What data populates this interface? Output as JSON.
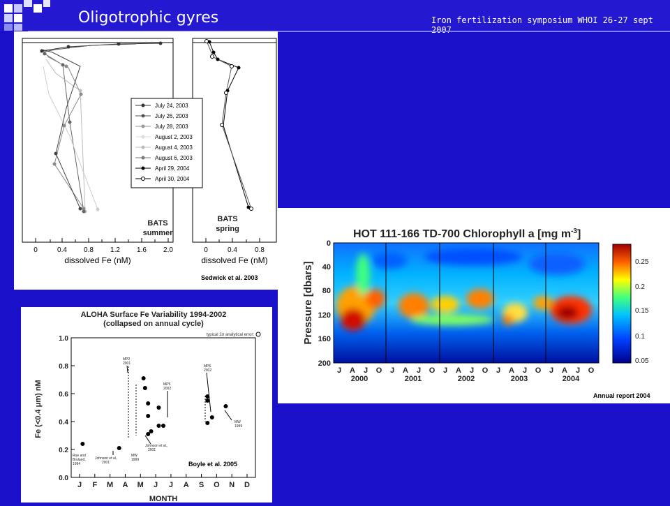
{
  "header": {
    "title": "Oligotrophic gyres",
    "subtitle": "Iron fertilization symposium  WHOI 26-27 sept 2007"
  },
  "panels": {
    "bats": {
      "citation": "Sedwick et al. 2003",
      "left_label": [
        "BATS",
        "summer"
      ],
      "right_label": [
        "BATS",
        "spring"
      ],
      "xlabel": "dissolved Fe (nM)",
      "left_ticks": [
        "0",
        "0.4",
        "0.8",
        "1.2",
        "1.6",
        "2.0"
      ],
      "right_ticks": [
        "0",
        "0.4",
        "0.8"
      ],
      "legend": [
        "July 24, 2003",
        "July 26, 2003",
        "July 28, 2003",
        "August 2, 2003",
        "August 4, 2003",
        "August 6, 2003",
        "April 29, 2004",
        "April 30, 2004"
      ]
    },
    "hot": {
      "title": "HOT 111-166 TD-700 Chlorophyll a [mg m",
      "title_sup": "-3",
      "title_end": "]",
      "ylabel": "Pressure [dbars]",
      "yticks": [
        "0",
        "40",
        "80",
        "120",
        "160",
        "200"
      ],
      "month_letters": [
        "J",
        "A",
        "J",
        "O",
        "J",
        "A",
        "J",
        "O",
        "J",
        "A",
        "J",
        "O",
        "J",
        "A",
        "J",
        "O",
        "J",
        "A",
        "J",
        "O"
      ],
      "years": [
        "2000",
        "2001",
        "2002",
        "2003",
        "2004"
      ],
      "colorbar_ticks": [
        "0.25",
        "0.2",
        "0.15",
        "0.1",
        "0.05"
      ],
      "citation": "Annual report 2004"
    },
    "aloha": {
      "title_line1": "ALOHA Surface Fe Variability 1994-2002",
      "title_line2": "(collapsed on annual cycle)",
      "error_note": "typical 2σ analytical error:",
      "ylabel": "Fe (<0.4 μm) nM",
      "xlabel": "MONTH",
      "yticks": [
        "0.0",
        "0.2",
        "0.4",
        "0.6",
        "0.8",
        "1.0"
      ],
      "months": [
        "J",
        "F",
        "M",
        "A",
        "M",
        "J",
        "J",
        "A",
        "S",
        "O",
        "N",
        "D"
      ],
      "citation": "Boyle et al. 2005",
      "annotations": [
        "MP2\n2001",
        "MP5\n2002",
        "MP6\n2002",
        "Johnson et al.,\n2001",
        "Johnson et al.,\n2001",
        "MW\n1999",
        "MW\n1999",
        "Rue and\nBruland,\n1994"
      ]
    }
  },
  "chart_data": [
    {
      "type": "scatter",
      "title": "ALOHA Surface Fe Variability 1994-2002 (collapsed on annual cycle)",
      "xlabel": "MONTH",
      "ylabel": "Fe (<0.4 μm) nM",
      "ylim": [
        0,
        1.0
      ],
      "x": [
        "J",
        "J",
        "M",
        "M",
        "M",
        "M",
        "M",
        "M",
        "M",
        "J",
        "J",
        "J",
        "O",
        "O",
        "O",
        "O",
        "O",
        "N"
      ],
      "points": [
        {
          "month": 1.2,
          "value": 0.24
        },
        {
          "month": 3.6,
          "value": 0.21
        },
        {
          "month": 5.2,
          "value": 0.71
        },
        {
          "month": 5.3,
          "value": 0.64
        },
        {
          "month": 5.5,
          "value": 0.53
        },
        {
          "month": 5.5,
          "value": 0.44
        },
        {
          "month": 5.7,
          "value": 0.33
        },
        {
          "month": 5.5,
          "value": 0.31
        },
        {
          "month": 6.2,
          "value": 0.5
        },
        {
          "month": 6.2,
          "value": 0.37
        },
        {
          "month": 6.5,
          "value": 0.37
        },
        {
          "month": 9.4,
          "value": 0.58
        },
        {
          "month": 9.4,
          "value": 0.55
        },
        {
          "month": 9.7,
          "value": 0.43
        },
        {
          "month": 9.4,
          "value": 0.39
        },
        {
          "month": 10.6,
          "value": 0.51
        }
      ]
    }
  ]
}
